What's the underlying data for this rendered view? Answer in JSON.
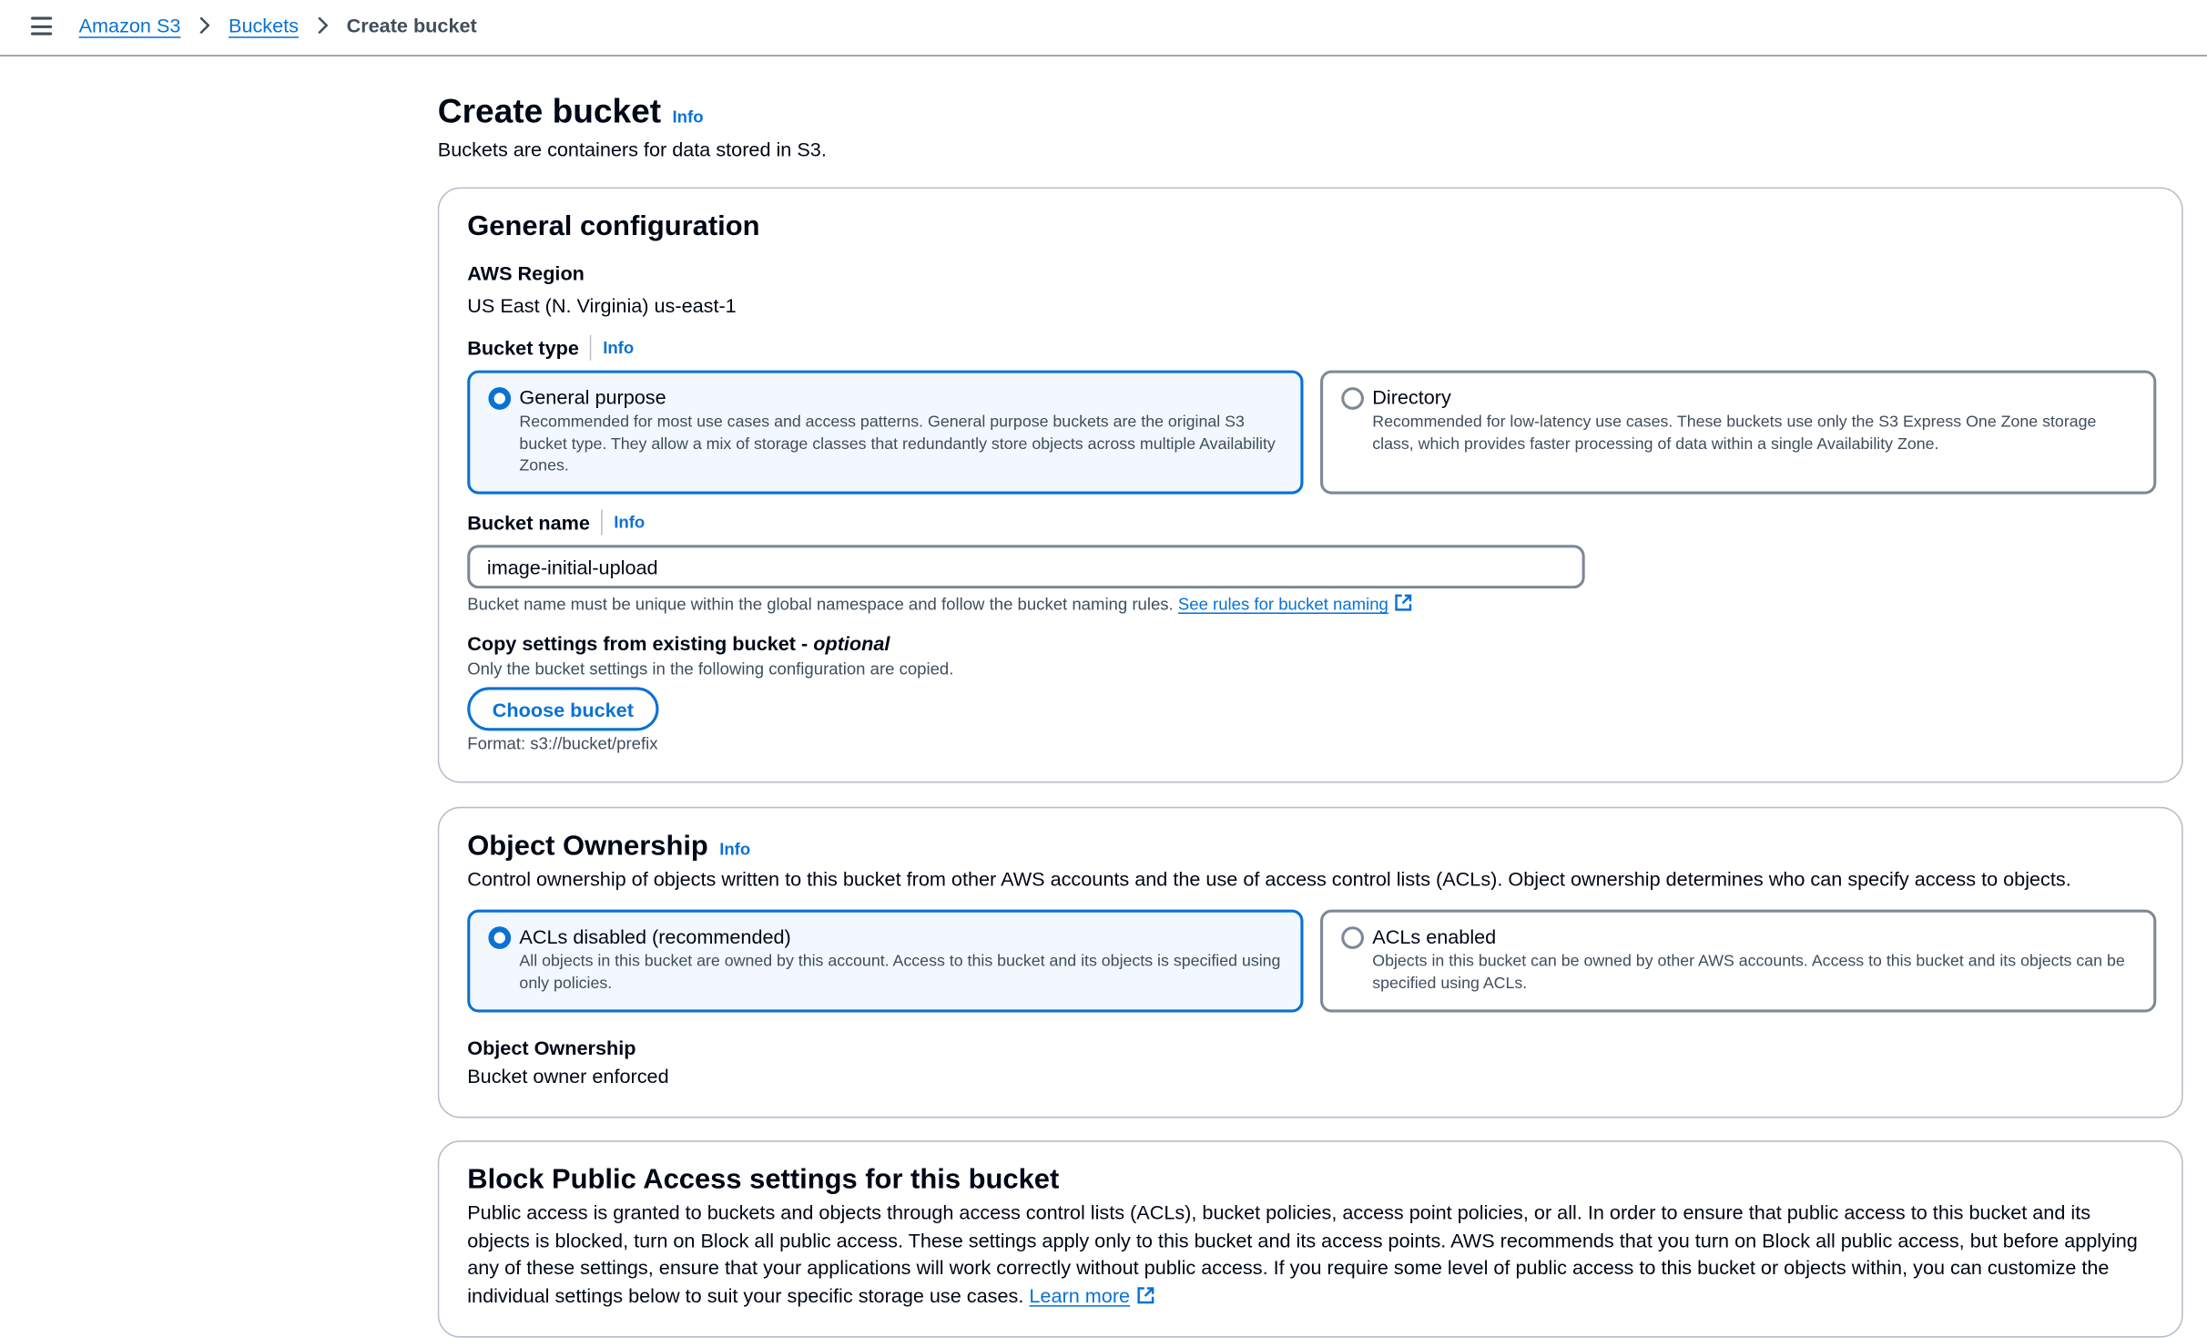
{
  "breadcrumb": {
    "items": [
      "Amazon S3",
      "Buckets"
    ],
    "current": "Create bucket"
  },
  "page": {
    "title": "Create bucket",
    "info": "Info",
    "description": "Buckets are containers for data stored in S3."
  },
  "general": {
    "title": "General configuration",
    "region_label": "AWS Region",
    "region_value": "US East (N. Virginia) us-east-1",
    "bucket_type_label": "Bucket type",
    "info": "Info",
    "types": [
      {
        "title": "General purpose",
        "description": "Recommended for most use cases and access patterns. General purpose buckets are the original S3 bucket type. They allow a mix of storage classes that redundantly store objects across multiple Availability Zones.",
        "selected": true
      },
      {
        "title": "Directory",
        "description": "Recommended for low-latency use cases. These buckets use only the S3 Express One Zone storage class, which provides faster processing of data within a single Availability Zone.",
        "selected": false
      }
    ],
    "bucket_name_label": "Bucket name",
    "bucket_name_value": "image-initial-upload",
    "bucket_name_hint": "Bucket name must be unique within the global namespace and follow the bucket naming rules.",
    "bucket_name_link": "See rules for bucket naming",
    "copy_label": "Copy settings from existing bucket - ",
    "copy_optional": "optional",
    "copy_hint": "Only the bucket settings in the following configuration are copied.",
    "choose_button": "Choose bucket",
    "format_hint": "Format: s3://bucket/prefix"
  },
  "ownership": {
    "title": "Object Ownership",
    "info": "Info",
    "description": "Control ownership of objects written to this bucket from other AWS accounts and the use of access control lists (ACLs). Object ownership determines who can specify access to objects.",
    "options": [
      {
        "title": "ACLs disabled (recommended)",
        "description": "All objects in this bucket are owned by this account. Access to this bucket and its objects is specified using only policies.",
        "selected": true
      },
      {
        "title": "ACLs enabled",
        "description": "Objects in this bucket can be owned by other AWS accounts. Access to this bucket and its objects can be specified using ACLs.",
        "selected": false
      }
    ],
    "result_label": "Object Ownership",
    "result_value": "Bucket owner enforced"
  },
  "block": {
    "title": "Block Public Access settings for this bucket",
    "description": "Public access is granted to buckets and objects through access control lists (ACLs), bucket policies, access point policies, or all. In order to ensure that public access to this bucket and its objects is blocked, turn on Block all public access. These settings apply only to this bucket and its access points. AWS recommends that you turn on Block all public access, but before applying any of these settings, ensure that your applications will work correctly without public access. If you require some level of public access to this bucket or objects within, you can customize the individual settings below to suit your specific storage use cases.",
    "learn_more": "Learn more"
  },
  "colors": {
    "link": "#0972d3",
    "text": "#000716",
    "secondary_text": "#414d5c",
    "border": "#b6bec9",
    "selected_bg": "#f2f8fd"
  },
  "icons": {
    "menu": "hamburger-icon",
    "breadcrumb_separator": "chevron-right-icon",
    "external": "external-link-icon"
  }
}
